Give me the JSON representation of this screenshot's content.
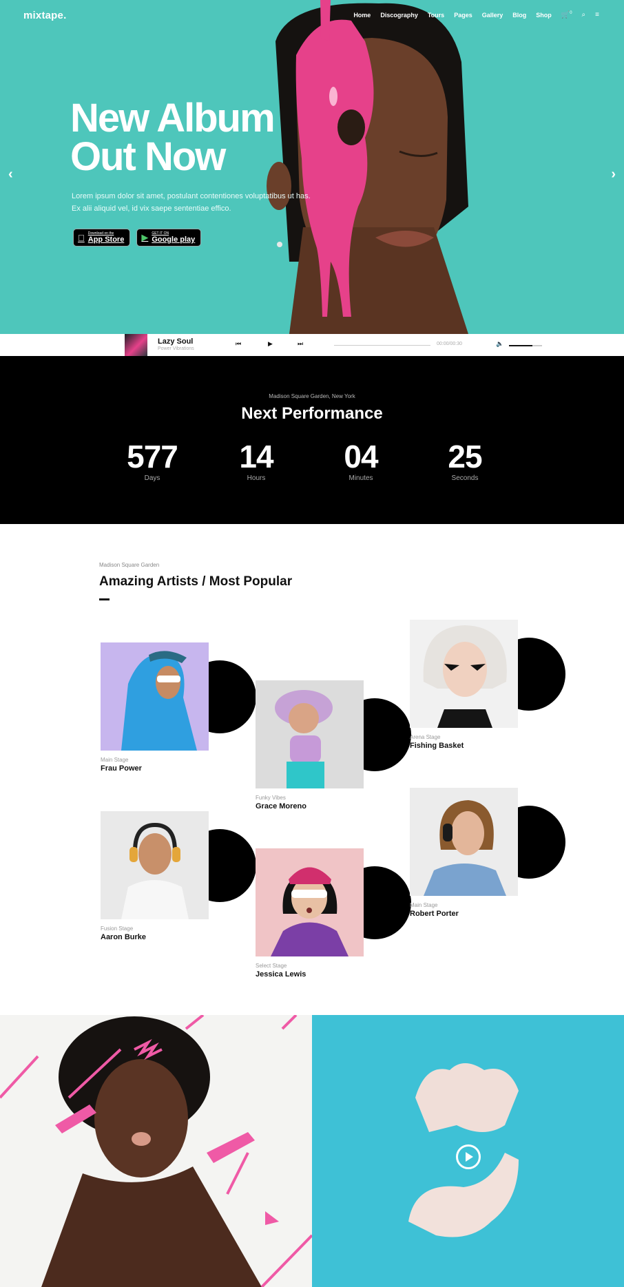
{
  "brand": {
    "logo": "mixtape."
  },
  "nav": {
    "items": [
      "Home",
      "Discography",
      "Tours",
      "Pages",
      "Gallery",
      "Blog",
      "Shop"
    ],
    "cart_count": "0"
  },
  "hero": {
    "title_line1": "New Album",
    "title_line2": "Out Now",
    "text_line1": "Lorem ipsum dolor sit amet, postulant contentiones voluptatibus ut has.",
    "text_line2": "Ex alii aliquid vel, id vix saepe sententiae effico.",
    "app_store": {
      "small": "Download on the",
      "big": "App Store"
    },
    "google_play": {
      "small": "GET IT ON",
      "big": "Google play"
    }
  },
  "player": {
    "track": "Lazy Soul",
    "artist": "Power Vibrations",
    "time": "00:00/00:30",
    "volume": 0.7
  },
  "performance": {
    "venue": "Madison Square Garden, New York",
    "title": "Next Performance",
    "countdown": [
      {
        "value": "577",
        "label": "Days"
      },
      {
        "value": "14",
        "label": "Hours"
      },
      {
        "value": "04",
        "label": "Minutes"
      },
      {
        "value": "25",
        "label": "Seconds"
      }
    ]
  },
  "artists": {
    "eyebrow": "Madison Square Garden",
    "title": "Amazing Artists / Most Popular",
    "items": [
      {
        "stage": "Main Stage",
        "name": "Frau Power"
      },
      {
        "stage": "Funky Vibes",
        "name": "Grace Moreno"
      },
      {
        "stage": "Arena Stage",
        "name": "Fishing Basket"
      },
      {
        "stage": "Fusion Stage",
        "name": "Aaron Burke"
      },
      {
        "stage": "Select Stage",
        "name": "Jessica Lewis"
      },
      {
        "stage": "Main Stage",
        "name": "Robert Porter"
      }
    ]
  },
  "colors": {
    "hero_bg": "#4ec6bb",
    "accent_pink": "#e6418a",
    "bottom_right_bg": "#3ec1d6"
  }
}
